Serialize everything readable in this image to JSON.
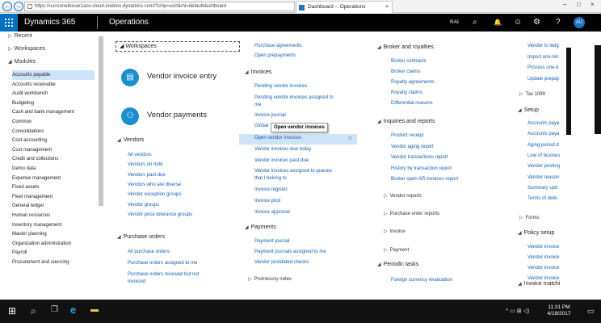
{
  "browser": {
    "url": "https://usnconeboxax1aos.cloud.onebox.dynamics.com/?cmp=usrt&mi=defaultdashboard",
    "tab_title": "Dashboard -- Operations",
    "tab_close": "×",
    "back": "←",
    "forward": "→"
  },
  "appbar": {
    "app_name": "Dynamics 365",
    "module_name": "Operations",
    "legal_entity": "RAI",
    "search": "⌕",
    "bell": "🔔",
    "smile": "☺",
    "gear": "⚙",
    "help": "?",
    "avatar": "AU"
  },
  "nav": {
    "recent": "Recent",
    "workspaces": "Workspaces",
    "modules": "Modules",
    "items": [
      "Accounts payable",
      "Accounts receivable",
      "Audit workbench",
      "Budgeting",
      "Cash and bank management",
      "Common",
      "Consolidations",
      "Cost accounting",
      "Cost management",
      "Credit and collections",
      "Demo data",
      "Expense management",
      "Fixed assets",
      "Fleet management",
      "General ledger",
      "Human resources",
      "Inventory management",
      "Master planning",
      "Organization administration",
      "Payroll",
      "Procurement and sourcing"
    ]
  },
  "col1": {
    "workspaces_header": "Workspaces",
    "tile1": "Vendor invoice entry",
    "tile2": "Vendor payments",
    "vendors_header": "Vendors",
    "vendors": [
      "All vendors",
      "Vendors on hold",
      "Vendors past due",
      "Vendors who are diverse",
      "Vendor exception groups",
      "Vendor groups",
      "Vendor price tolerance groups"
    ],
    "po_header": "Purchase orders",
    "po": [
      "All purchase orders",
      "Purchase orders assigned to me",
      "Purchase orders received but not",
      "invoiced"
    ]
  },
  "col2": {
    "top": [
      "Purchase agreements",
      "Open prepayments"
    ],
    "invoices_header": "Invoices",
    "invoices": [
      "Pending vendor invoices",
      "Pending vendor invoices assigned to",
      "me",
      "Invoice journal",
      "Global",
      "Open vendor invoices",
      "Vendor invoices due today",
      "Vendor invoices past due",
      "Vendor invoices assigned to queues",
      "that I belong to",
      "Invoice register",
      "Invoice pool",
      "Invoice approval"
    ],
    "tooltip": "Open vendor invoices",
    "payments_header": "Payments",
    "payments": [
      "Payment journal",
      "Payment journals assigned to me",
      "Vendor postdated checks"
    ],
    "promissory": "Promissory notes"
  },
  "col3": {
    "broker_header": "Broker and royalties",
    "broker": [
      "Broker contracts",
      "Broker claims",
      "Royalty agreements",
      "Royalty claims",
      "Differential reasons"
    ],
    "inquiries_header": "Inquiries and reports",
    "inquiries": [
      "Product receipt",
      "Vendor aging report",
      "Vendor transactions report",
      "History by transaction report",
      "Broker open AR invoices report"
    ],
    "vendor_reports": "Vendor reports",
    "po_reports": "Purchase order reports",
    "invoice": "Invoice",
    "payment": "Payment",
    "periodic_header": "Periodic tasks",
    "periodic": [
      "Foreign currency revaluation"
    ]
  },
  "col4": {
    "top": [
      "Vendor to ledg",
      "Import one-tim",
      "Process one-ti",
      "Update prepay"
    ],
    "tax": "Tax 1099",
    "setup_header": "Setup",
    "setup": [
      "Accounts paya",
      "Accounts paya",
      "Aging period d",
      "Line of busines",
      "Vendor posting",
      "Vendor reason",
      "Summary upd",
      "Terms of deliv"
    ],
    "forms": "Forms",
    "policy_header": "Policy setup",
    "policy": [
      "Vendor invoice",
      "Vendor invoice",
      "Vendor invoice",
      "Vendor invoice"
    ],
    "matching": "Invoice matchi"
  },
  "taskbar": {
    "start": "⊞",
    "search": "⌕",
    "task_view": "❐",
    "browser": "e",
    "explorer": "▬",
    "tray": "^ ▭ ⊠ ◁)",
    "time": "11:31 PM",
    "date": "4/19/2017"
  },
  "colors": {
    "accent": "#0070c0",
    "link": "#1660b4",
    "selection": "#cde3f7"
  }
}
